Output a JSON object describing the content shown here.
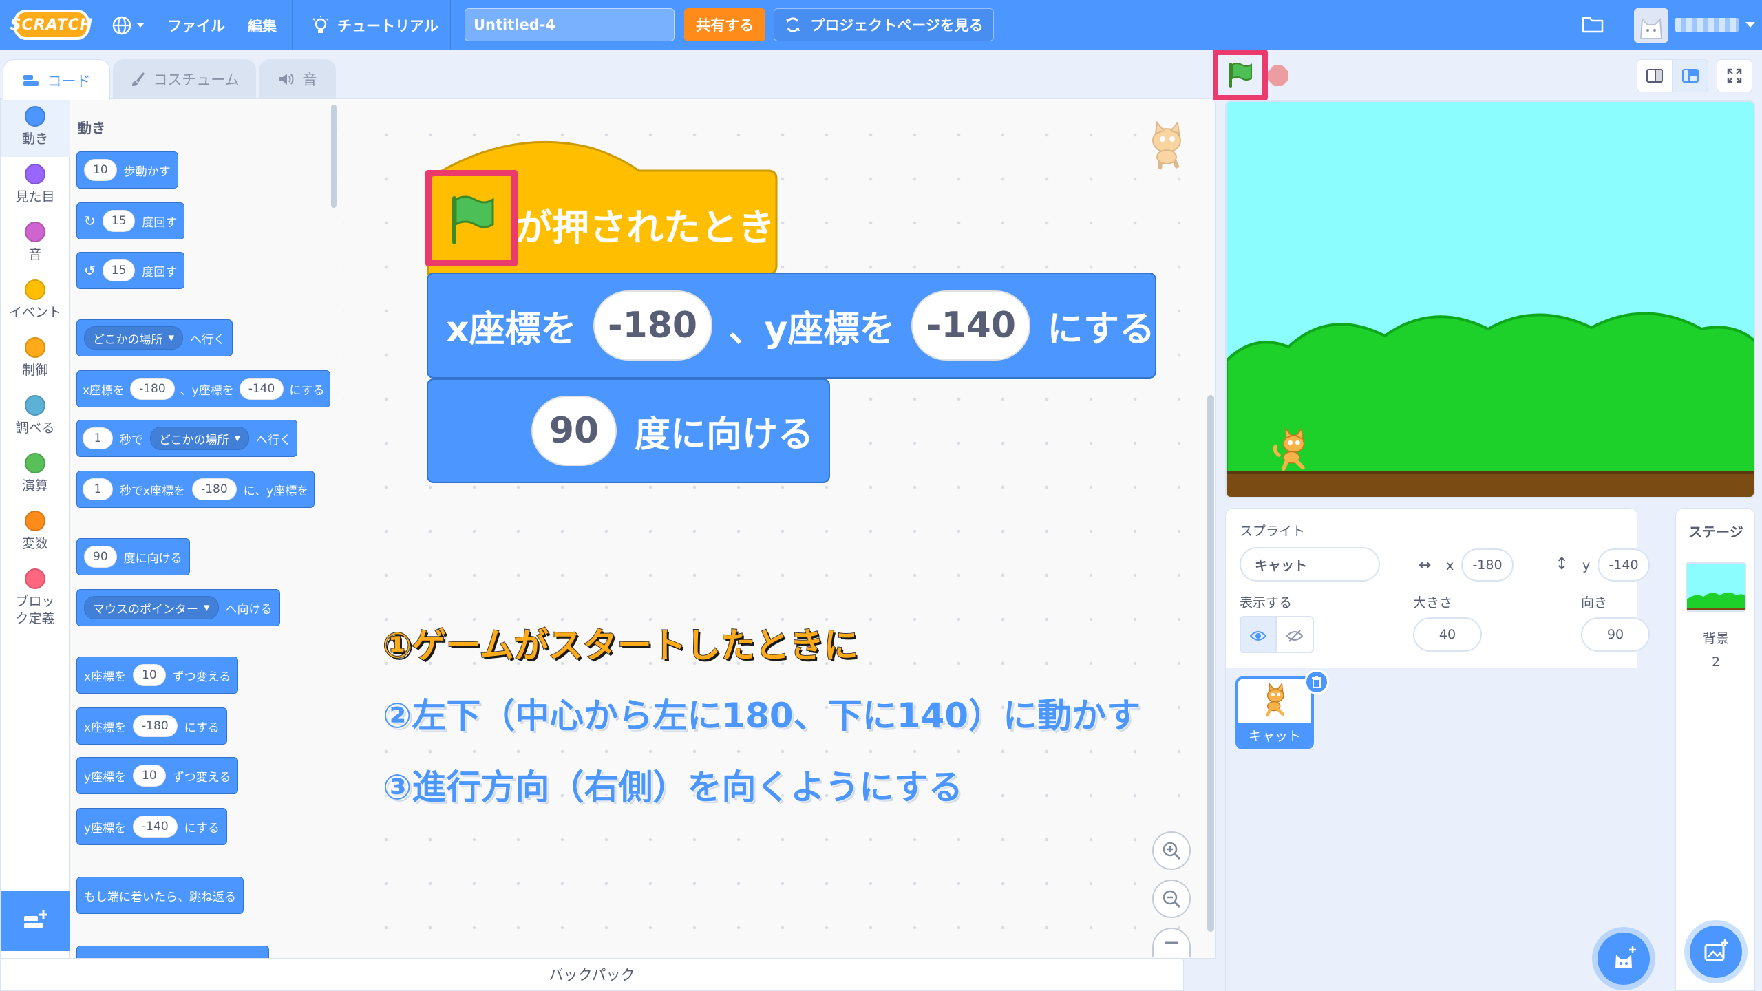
{
  "menubar": {
    "logo": "SCRATCH",
    "file": "ファイル",
    "edit": "編集",
    "tutorials": "チュートリアル",
    "project_title": "Untitled-4",
    "share": "共有する",
    "see_project_page": "プロジェクトページを見る"
  },
  "tabs": {
    "code": "コード",
    "costumes": "コスチューム",
    "sounds": "音"
  },
  "categories": [
    {
      "label": "動き",
      "color": "#4c97ff"
    },
    {
      "label": "見た目",
      "color": "#9966ff"
    },
    {
      "label": "音",
      "color": "#cf63cf"
    },
    {
      "label": "イベント",
      "color": "#ffbf00"
    },
    {
      "label": "制御",
      "color": "#ffab19"
    },
    {
      "label": "調べる",
      "color": "#5cb1d6"
    },
    {
      "label": "演算",
      "color": "#59c059"
    },
    {
      "label": "変数",
      "color": "#ff8c1a"
    },
    {
      "label": "ブロック定義",
      "color": "#ff6680"
    }
  ],
  "palette": {
    "heading": "動き",
    "move": {
      "value": "10",
      "label": "歩動かす"
    },
    "turn_right": {
      "value": "15",
      "label": "度回す"
    },
    "turn_left": {
      "value": "15",
      "label": "度回す"
    },
    "goto": {
      "dropdown": "どこかの場所",
      "label": "へ行く"
    },
    "gotoxy": {
      "x_label": "x座標を",
      "x": "-180",
      "y_label": "、y座標を",
      "y": "-140",
      "suffix": "にする"
    },
    "glide": {
      "secs": "1",
      "label": "秒で",
      "dropdown": "どこかの場所",
      "suffix": "へ行く"
    },
    "glidexy": {
      "secs": "1",
      "label": "秒でx座標を",
      "x": "-180",
      "y_label": "に、y座標を"
    },
    "point_dir": {
      "value": "90",
      "label": "度に向ける"
    },
    "point_towards": {
      "dropdown": "マウスのポインター",
      "label": "へ向ける"
    },
    "change_x": {
      "label": "x座標を",
      "value": "10",
      "suffix": "ずつ変える"
    },
    "set_x": {
      "label": "x座標を",
      "value": "-180",
      "suffix": "にする"
    },
    "change_y": {
      "label": "y座標を",
      "value": "10",
      "suffix": "ずつ変える"
    },
    "set_y": {
      "label": "y座標を",
      "value": "-140",
      "suffix": "にする"
    },
    "bounce": {
      "label": "もし端に着いたら、跳ね返る"
    }
  },
  "script": {
    "hat_label": "が押されたとき",
    "goto_x_label": "x座標を",
    "goto_x": "-180",
    "goto_y_label": "、y座標を",
    "goto_y": "-140",
    "goto_suffix": "にする",
    "dir_value": "90",
    "dir_label": "度に向ける"
  },
  "annotations": {
    "a1": "①ゲームがスタートしたときに",
    "a2": "②左下（中心から左に180、下に140）に動かす",
    "a3": "③進行方向（右側）を向くようにする"
  },
  "backpack": "バックパック",
  "sprite_info": {
    "sprite_label": "スプライト",
    "sprite_name": "キャット",
    "x_label": "x",
    "x": "-180",
    "y_label": "y",
    "y": "-140",
    "show_label": "表示する",
    "size_label": "大きさ",
    "size": "40",
    "direction_label": "向き",
    "direction": "90"
  },
  "sprite_list": [
    {
      "name": "キャット"
    }
  ],
  "stage_pane": {
    "title": "ステージ",
    "backdrops_label": "背景",
    "backdrops_count": "2"
  },
  "colors": {
    "motion": "#4c97ff",
    "events": "#ffbf00",
    "highlight": "#ea3b6c",
    "share": "#ff8c1a"
  }
}
